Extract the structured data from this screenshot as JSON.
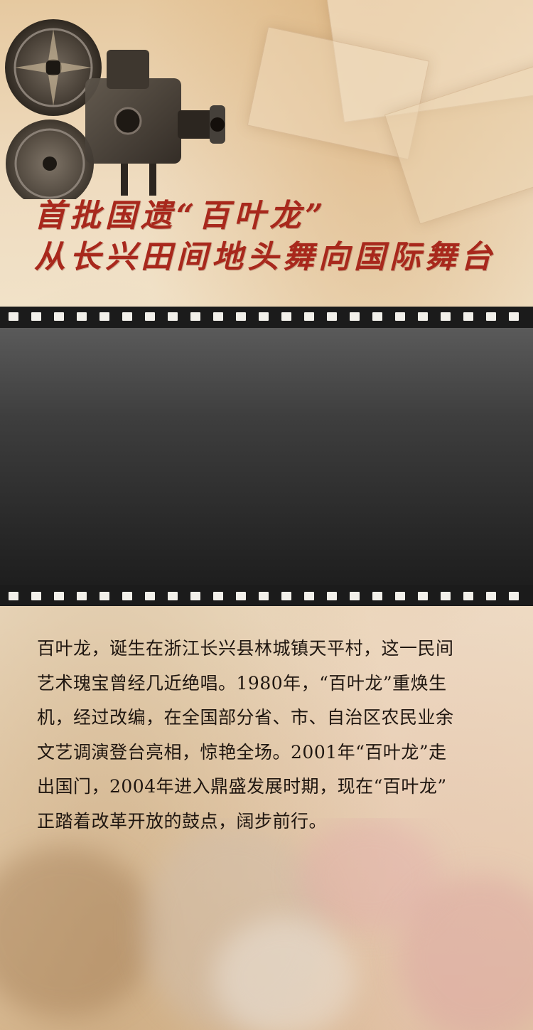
{
  "header": {
    "title_line1": "首批国遗“百叶龙”",
    "title_line2": "从长兴田间地头舞向国际舞台",
    "title_color": "#a8281c"
  },
  "film_strip": {
    "frame_color": "#3a3a3a",
    "hole_color": "#f2f0ea"
  },
  "article": {
    "lines": [
      "百叶龙，诞生在浙江长兴县林城镇天平村，这一民间",
      "艺术瑰宝曾经几近绝唱。1980年，“百叶龙”重焕生",
      "机，经过改编，在全国部分省、市、自治区农民业余",
      "文艺调演登台亮相，惊艳全场。2001年“百叶龙”走",
      "出国门，2004年进入鼎盛发展时期，现在“百叶龙”",
      "正踏着改革开放的鼓点，阔步前行。"
    ]
  },
  "icons": {
    "projector": "film-projector-icon"
  }
}
